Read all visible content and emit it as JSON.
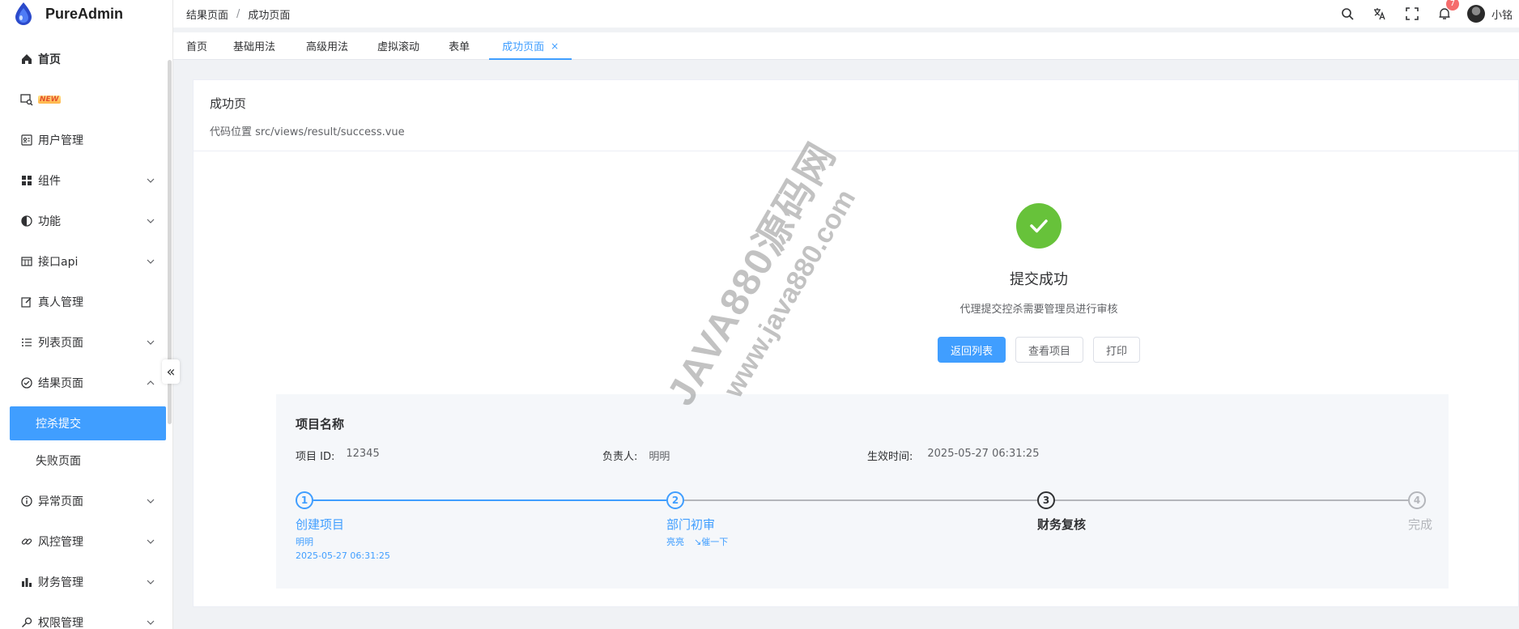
{
  "app": {
    "name": "PureAdmin"
  },
  "sidebar": {
    "items": [
      {
        "label": "首页",
        "icon": "home-icon"
      },
      {
        "label": "",
        "icon": "search-doc-icon",
        "badge": "NEW"
      },
      {
        "label": "用户管理",
        "icon": "user-card-icon"
      },
      {
        "label": "组件",
        "icon": "grid-icon"
      },
      {
        "label": "功能",
        "icon": "circle-half-icon"
      },
      {
        "label": "接口api",
        "icon": "table-icon"
      },
      {
        "label": "真人管理",
        "icon": "edit-icon"
      },
      {
        "label": "列表页面",
        "icon": "list-icon"
      },
      {
        "label": "结果页面",
        "icon": "check-circle-icon"
      }
    ],
    "result_sub": [
      {
        "label": "控杀提交"
      },
      {
        "label": "失败页面"
      }
    ],
    "after": [
      {
        "label": "异常页面",
        "icon": "info-icon"
      },
      {
        "label": "风控管理",
        "icon": "link-icon"
      },
      {
        "label": "财务管理",
        "icon": "bar-chart-icon"
      },
      {
        "label": "权限管理",
        "icon": "key-icon"
      }
    ],
    "collapse_glyph": "«"
  },
  "header": {
    "breadcrumb": [
      "结果页面",
      "成功页面"
    ],
    "separator": "/",
    "notification_count": "7",
    "user_name": "小铭"
  },
  "tags": [
    {
      "label": "首页"
    },
    {
      "label": "基础用法"
    },
    {
      "label": "高级用法"
    },
    {
      "label": "虚拟滚动"
    },
    {
      "label": "表单"
    },
    {
      "label": "成功页面",
      "active": true,
      "close": "×"
    }
  ],
  "card": {
    "title": "成功页",
    "subtitle": "代码位置 src/views/result/success.vue"
  },
  "result": {
    "title": "提交成功",
    "subtitle": "代理提交控杀需要管理员进行审核",
    "buttons": [
      "返回列表",
      "查看项目",
      "打印"
    ]
  },
  "panel": {
    "title": "项目名称",
    "project_id_label": "项目 ID:",
    "project_id": "12345",
    "owner_label": "负责人:",
    "owner": "明明",
    "effective_label": "生效时间:",
    "effective_time": "2025-05-27 06:31:25"
  },
  "steps": [
    {
      "num": "1",
      "title": "创建项目",
      "desc1": "明明",
      "desc2": "2025-05-27 06:31:25",
      "state": "finish"
    },
    {
      "num": "2",
      "title": "部门初审",
      "desc1": "亮亮",
      "desc2": "催一下",
      "state": "finish"
    },
    {
      "num": "3",
      "title": "财务复核",
      "state": "process"
    },
    {
      "num": "4",
      "title": "完成",
      "state": "wait"
    }
  ],
  "watermark": {
    "line1": "JAVA880源码网",
    "line2": "www.java880.com"
  },
  "colors": {
    "primary": "#409eff",
    "success": "#67c23a",
    "danger": "#f56c6c"
  }
}
